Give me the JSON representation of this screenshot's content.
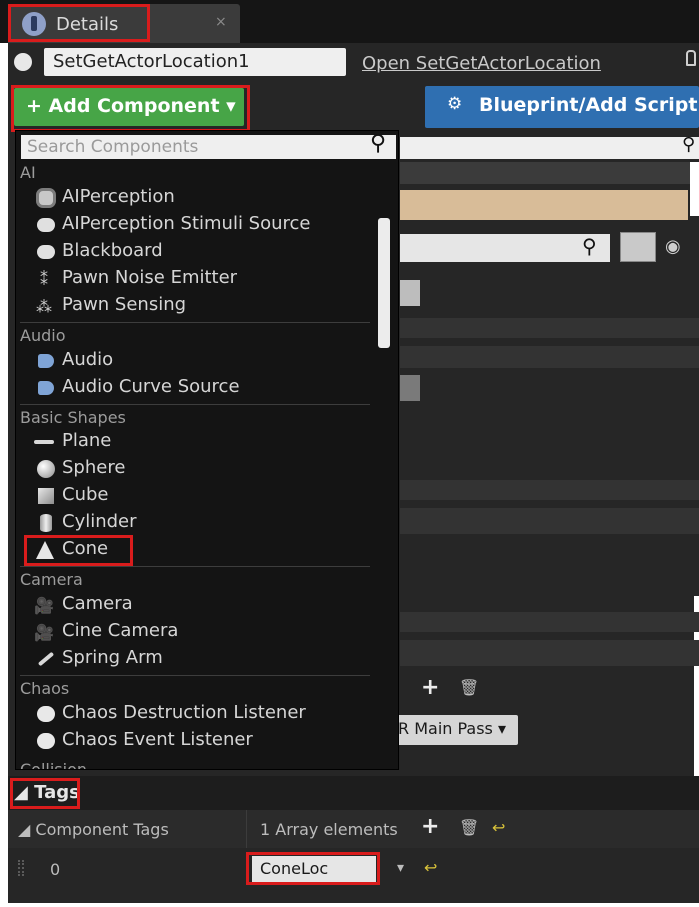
{
  "tab": {
    "title": "Details",
    "close": "×"
  },
  "actor": {
    "name": "SetGetActorLocation1",
    "open_link": "Open SetGetActorLocation"
  },
  "buttons": {
    "add_component": "+ Add Component ▾",
    "blueprint": "Blueprint/Add Script"
  },
  "search": {
    "placeholder": "Search Components"
  },
  "categories": {
    "ai": "AI",
    "audio": "Audio",
    "basic_shapes": "Basic Shapes",
    "camera": "Camera",
    "chaos": "Chaos",
    "collision": "Collision"
  },
  "items": {
    "ai_perception": "AIPerception",
    "ai_perception_stimuli": "AIPerception Stimuli Source",
    "blackboard": "Blackboard",
    "pawn_noise": "Pawn Noise Emitter",
    "pawn_sensing": "Pawn Sensing",
    "audio": "Audio",
    "audio_curve": "Audio Curve Source",
    "plane": "Plane",
    "sphere": "Sphere",
    "cube": "Cube",
    "cylinder": "Cylinder",
    "cone": "Cone",
    "camera": "Camera",
    "cine_camera": "Cine Camera",
    "spring_arm": "Spring Arm",
    "chaos_destruction": "Chaos Destruction Listener",
    "chaos_event": "Chaos Event Listener"
  },
  "background": {
    "main_pass": "R Main Pass ▾"
  },
  "tags": {
    "section_title": "◢ Tags",
    "component_tags_label": "◢ Component Tags",
    "array_elements": "1 Array elements",
    "index": "0",
    "value": "ConeLoc"
  },
  "colors": {
    "highlight": "#d91c1c",
    "add_green": "#47a547",
    "blueprint_blue": "#2f6fb1",
    "panel": "#262626"
  }
}
